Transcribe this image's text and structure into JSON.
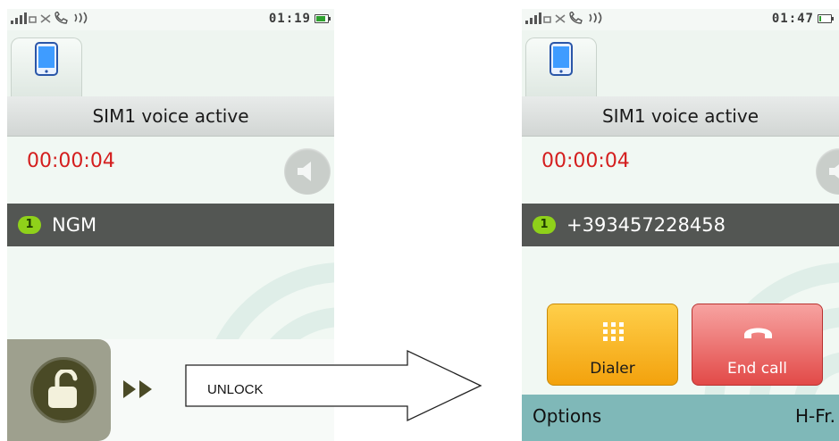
{
  "left_screen": {
    "status": {
      "time": "01:19",
      "battery_level": 0.85
    },
    "header": "SIM1 voice active",
    "timer": "00:00:04",
    "caller": {
      "sim": "1",
      "name": "NGM"
    }
  },
  "right_screen": {
    "status": {
      "time": "01:47",
      "battery_level": 0.2
    },
    "header": "SIM1 voice active",
    "timer": "00:00:04",
    "caller": {
      "sim": "1",
      "name": "+393457228458"
    },
    "buttons": {
      "dialer": "Dialer",
      "end_call": "End call"
    },
    "softkeys": {
      "left": "Options",
      "right": "H-Fr."
    }
  },
  "transition": {
    "label": "UNLOCK"
  },
  "colors": {
    "timer_red": "#d41e1e",
    "caller_row": "#535653",
    "sim_badge": "#8fd11a",
    "dialer": "#f3a20d",
    "end_call": "#e24a48",
    "softkey_bar": "#7fb8b8"
  }
}
